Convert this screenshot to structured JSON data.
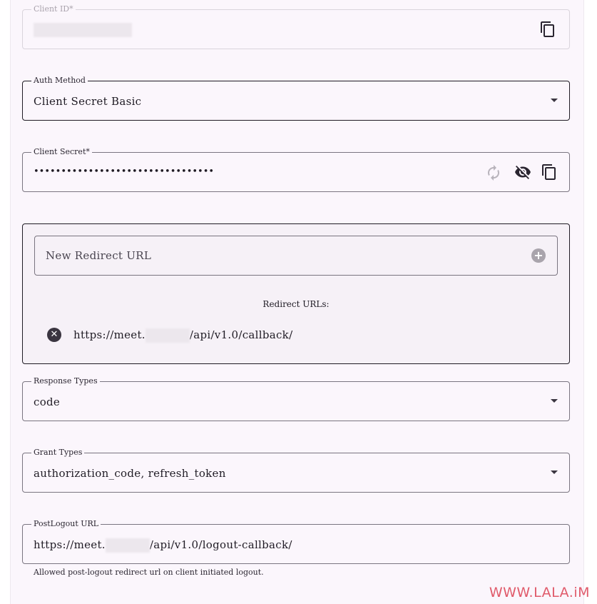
{
  "client_id": {
    "label": "Client ID*"
  },
  "auth_method": {
    "label": "Auth Method",
    "value": "Client Secret Basic"
  },
  "client_secret": {
    "label": "Client Secret*",
    "value": "•••••••••••••••••••••••••••••••••"
  },
  "redirect": {
    "new_placeholder": "New Redirect URL",
    "list_label": "Redirect URLs:",
    "urls": [
      {
        "prefix": "https://meet.",
        "suffix": "/api/v1.0/callback/"
      }
    ]
  },
  "response_types": {
    "label": "Response Types",
    "value": "code"
  },
  "grant_types": {
    "label": "Grant Types",
    "value": "authorization_code, refresh_token"
  },
  "post_logout": {
    "label": "PostLogout URL",
    "prefix": "https://meet.",
    "suffix": "/api/v1.0/logout-callback/",
    "helper": "Allowed post-logout redirect url on client initiated logout."
  },
  "watermark": "WWW.LALA.iM",
  "colors": {
    "accent_watermark": "#e05a6a",
    "panel_bg": "#fbf6fc",
    "border": "#7a7580"
  },
  "icons": {
    "copy": "copy-icon",
    "refresh": "refresh-icon",
    "visibility_off": "visibility-off-icon",
    "add": "add-circle-icon",
    "remove": "cancel-circle-icon",
    "dropdown": "arrow-drop-down-icon"
  }
}
